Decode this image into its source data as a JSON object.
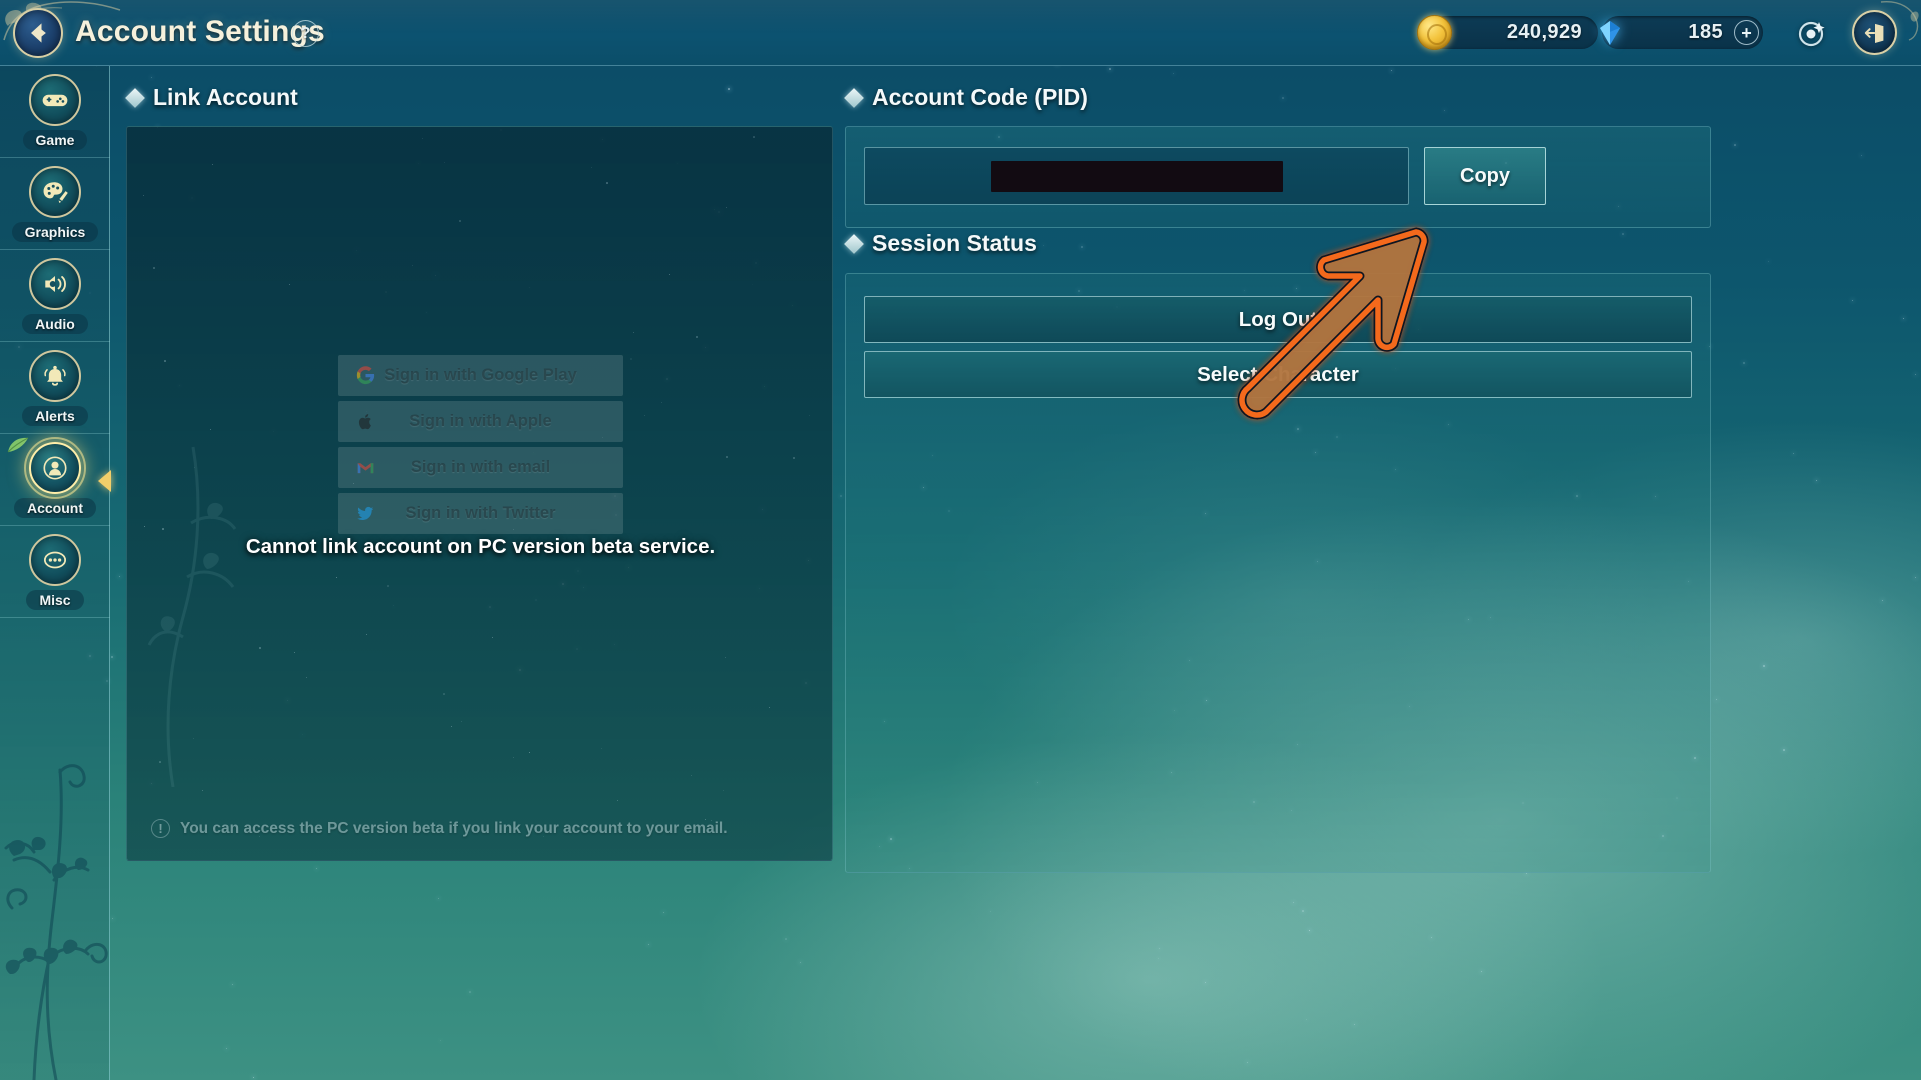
{
  "header": {
    "back_icon": "back-arrow-icon",
    "title": "Account Settings",
    "help_label": "?",
    "coin_icon": "gold-coin-icon",
    "coin_value": "240,929",
    "gem_icon": "blue-gem-icon",
    "gem_value": "185",
    "gem_add_label": "+",
    "target_icon": "target-orb-icon",
    "exit_icon": "exit-door-icon"
  },
  "sidebar": {
    "items": [
      {
        "label": "Game",
        "icon": "gamepad-icon",
        "selected": false
      },
      {
        "label": "Graphics",
        "icon": "palette-icon",
        "selected": false
      },
      {
        "label": "Audio",
        "icon": "speaker-icon",
        "selected": false
      },
      {
        "label": "Alerts",
        "icon": "bell-icon",
        "selected": false
      },
      {
        "label": "Account",
        "icon": "person-icon",
        "selected": true
      },
      {
        "label": "Misc",
        "icon": "ellipsis-icon",
        "selected": false
      }
    ]
  },
  "link_account": {
    "section_title": "Link Account",
    "buttons": [
      {
        "label": "Sign in with Google Play",
        "icon": "google-icon",
        "disabled": true
      },
      {
        "label": "Sign in with Apple",
        "icon": "apple-icon",
        "disabled": true
      },
      {
        "label": "Sign in with email",
        "icon": "gmail-icon",
        "disabled": true
      },
      {
        "label": "Sign in with Twitter",
        "icon": "twitter-icon",
        "disabled": true
      }
    ],
    "overlay_message": "Cannot link account on PC version beta service.",
    "footnote": "You can access the PC version beta if you link your account to your email.",
    "footnote_icon": "exclamation-icon"
  },
  "account_code": {
    "section_title": "Account Code (PID)",
    "field_value": "",
    "field_redacted": true,
    "copy_label": "Copy"
  },
  "session_status": {
    "section_title": "Session Status",
    "buttons": [
      {
        "label": "Log Out"
      },
      {
        "label": "Select Character"
      }
    ]
  },
  "annotation": {
    "type": "arrow-up-right",
    "fill_color": "#b2743f",
    "stroke_color": "#f4691a"
  },
  "colors": {
    "accent_gold": "#d8cfa5",
    "panel_teal": "#0d4a60",
    "text_light": "#f4f9fa",
    "bg_top": "#0b4a66",
    "bg_bottom": "#3d9183"
  }
}
